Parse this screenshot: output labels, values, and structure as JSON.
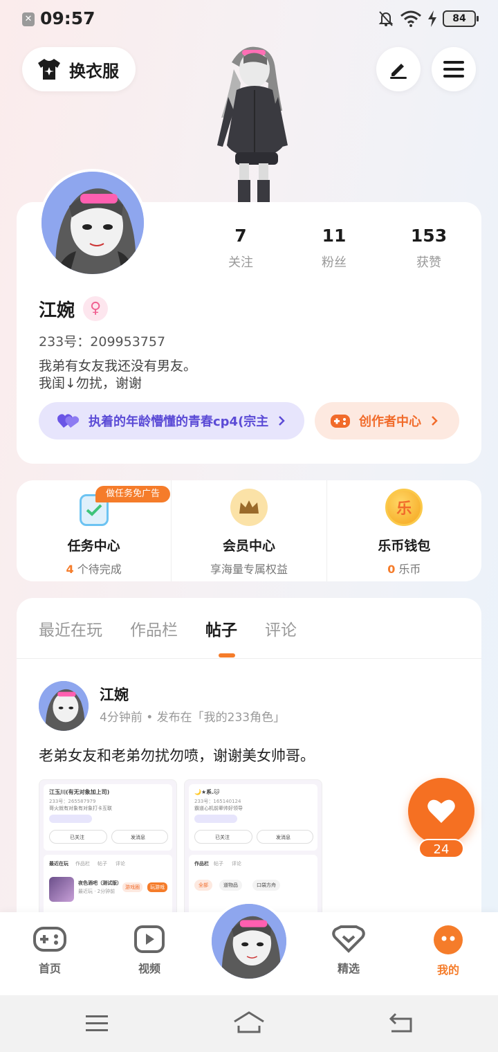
{
  "status_bar": {
    "time": "09:57",
    "battery": "84",
    "icons": [
      "close-icon",
      "bell-off-icon",
      "wifi-icon",
      "charging-icon",
      "battery-icon"
    ]
  },
  "header": {
    "outfit_label": "换衣服",
    "edit_icon": "pen-icon",
    "menu_icon": "hamburger-icon"
  },
  "profile": {
    "stats": [
      {
        "value": "7",
        "label": "关注"
      },
      {
        "value": "11",
        "label": "粉丝"
      },
      {
        "value": "153",
        "label": "获赞"
      }
    ],
    "name": "江婉",
    "gender_symbol": "♀",
    "uid": "233号：209953757",
    "bio_line1": "我弟有女友我还没有男友。",
    "bio_line2": "我闺↓勿扰，谢谢",
    "guild_label": "执着的年龄懵懂的青春cp4(宗主",
    "creator_label": "创作者中心"
  },
  "services": {
    "badge": "做任务免广告",
    "items": [
      {
        "title": "任务中心",
        "count": "4",
        "sub": " 个待完成",
        "icon": "clipboard-icon"
      },
      {
        "title": "会员中心",
        "sub": "享海量专属权益",
        "icon": "crown-icon"
      },
      {
        "title": "乐币钱包",
        "count": "0",
        "sub": " 乐币",
        "icon_text": "乐",
        "icon": "coin-icon"
      }
    ]
  },
  "tabs": [
    {
      "label": "最近在玩",
      "active": false
    },
    {
      "label": "作品栏",
      "active": false
    },
    {
      "label": "帖子",
      "active": true
    },
    {
      "label": "评论",
      "active": false
    }
  ],
  "post": {
    "author": "江婉",
    "meta": "4分钟前 • 发布在「我的233角色」",
    "text": "老弟女友和老弟勿扰勿喷，谢谢美女帅哥。",
    "image1": {
      "name": "江玉川(有无对象加上司)",
      "uid": "233号：265587979",
      "bio": "哥火就有对象有对象打卡互联",
      "followed": "已关注",
      "message": "发消息",
      "tabs": [
        "最近在玩",
        "作品栏",
        "帖子",
        "评论"
      ],
      "game_name": "夜色酒吧（测试版）",
      "game_meta": "最近玩 · 2分钟前",
      "game_btn1": "游戏圈",
      "game_btn2": "玩游戏"
    },
    "image2": {
      "name": "🌙★系.🐱",
      "uid": "233号：165140124",
      "bio": "霸道心机前辈帅好领导",
      "followed": "已关注",
      "message": "发消息",
      "tabs": [
        "作品栏",
        "帖子",
        "评论"
      ],
      "filters": [
        "全部",
        "道物品",
        "口袋方舟"
      ]
    },
    "likes": "24"
  },
  "bottom_nav": [
    {
      "label": "首页",
      "icon": "gamepad-icon",
      "active": false
    },
    {
      "label": "视频",
      "icon": "video-icon",
      "active": false
    },
    {
      "label": "精选",
      "icon": "heart-gem-icon",
      "active": false
    },
    {
      "label": "我的",
      "icon": "profile-face-icon",
      "active": true
    }
  ],
  "colors": {
    "accent": "#f57c2a",
    "guild": "#5b4bd6",
    "like": "#f57022"
  }
}
